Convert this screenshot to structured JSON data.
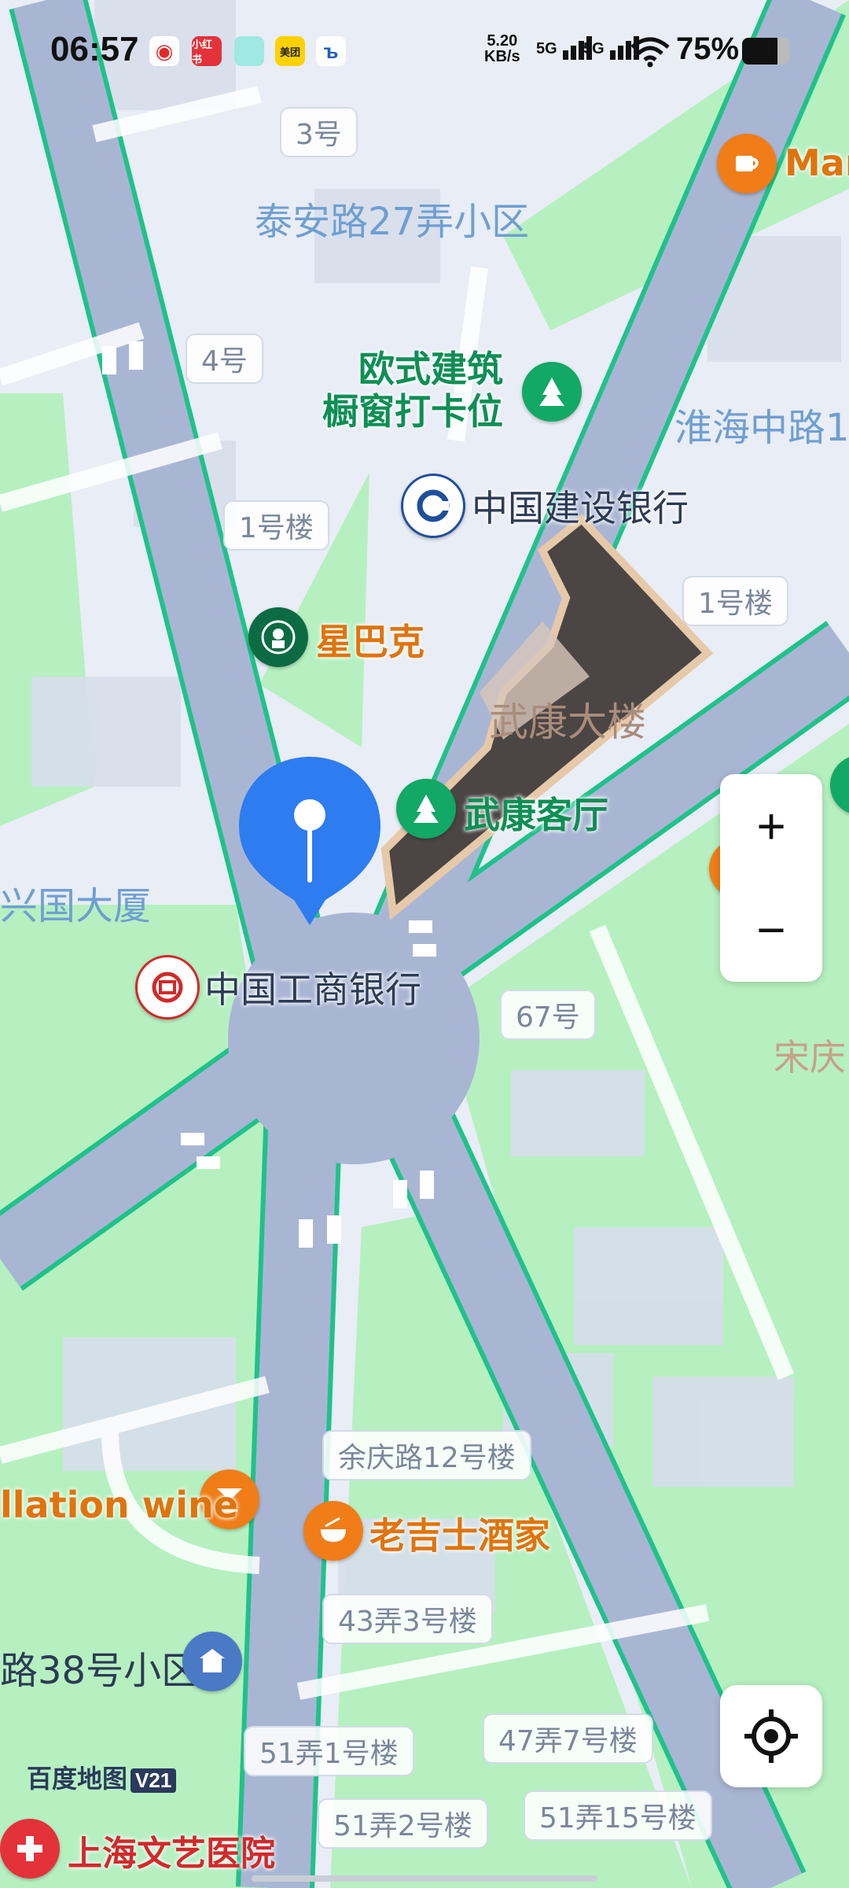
{
  "status_bar": {
    "time": "06:57",
    "speed_value": "5.20",
    "speed_unit": "KB/s",
    "network1": "5G",
    "network2": "5G",
    "battery": "75%",
    "battery_level": 0.75,
    "apps": [
      {
        "icon": "weibo-icon",
        "text": ""
      },
      {
        "icon": "xiaohongshu-icon",
        "text": "小红书"
      },
      {
        "icon": "app-icon",
        "text": ""
      },
      {
        "icon": "meituan-icon",
        "text": "美团"
      },
      {
        "icon": "bank-app-icon",
        "text": ""
      }
    ]
  },
  "map": {
    "buildings": {
      "b3": "3号",
      "b4": "4号",
      "b1a": "1号楼",
      "b1b": "1号楼",
      "b67": "67号",
      "yuqing12": "余庆路12号楼",
      "l43_3": "43弄3号楼",
      "l51_1": "51弄1号楼",
      "l47_7": "47弄7号楼",
      "l51_2": "51弄2号楼",
      "l51_15": "51弄15号楼"
    },
    "areas": {
      "taian": "泰安路27弄小区",
      "huaihai": "淮海中路1",
      "xingguo": "兴国大厦",
      "lu38": "路38号小区",
      "wukang_bldg": "武康大楼",
      "songqing": "宋庆"
    },
    "pois": {
      "european_1": "欧式建筑",
      "european_2": "橱窗打卡位",
      "ccb": "中国建设银行",
      "starbucks": "星巴克",
      "wukang_hall": "武康客厅",
      "icbc": "中国工商银行",
      "manner": "Man",
      "wine": "llation wine",
      "laojishi": "老吉士酒家",
      "hospital": "上海文艺医院",
      "right_partial": "宋庆"
    },
    "colors": {
      "road": "#a9b6d3",
      "road_edge": "#1fc28a",
      "park": "#b6f0c0",
      "block": "#d7deeb",
      "background": "#e9edf5",
      "location_pin": "#2d7cf0"
    }
  },
  "controls": {
    "zoom_in": "+",
    "zoom_out": "−"
  },
  "branding": {
    "logo": "百度地图",
    "version": "V21"
  }
}
